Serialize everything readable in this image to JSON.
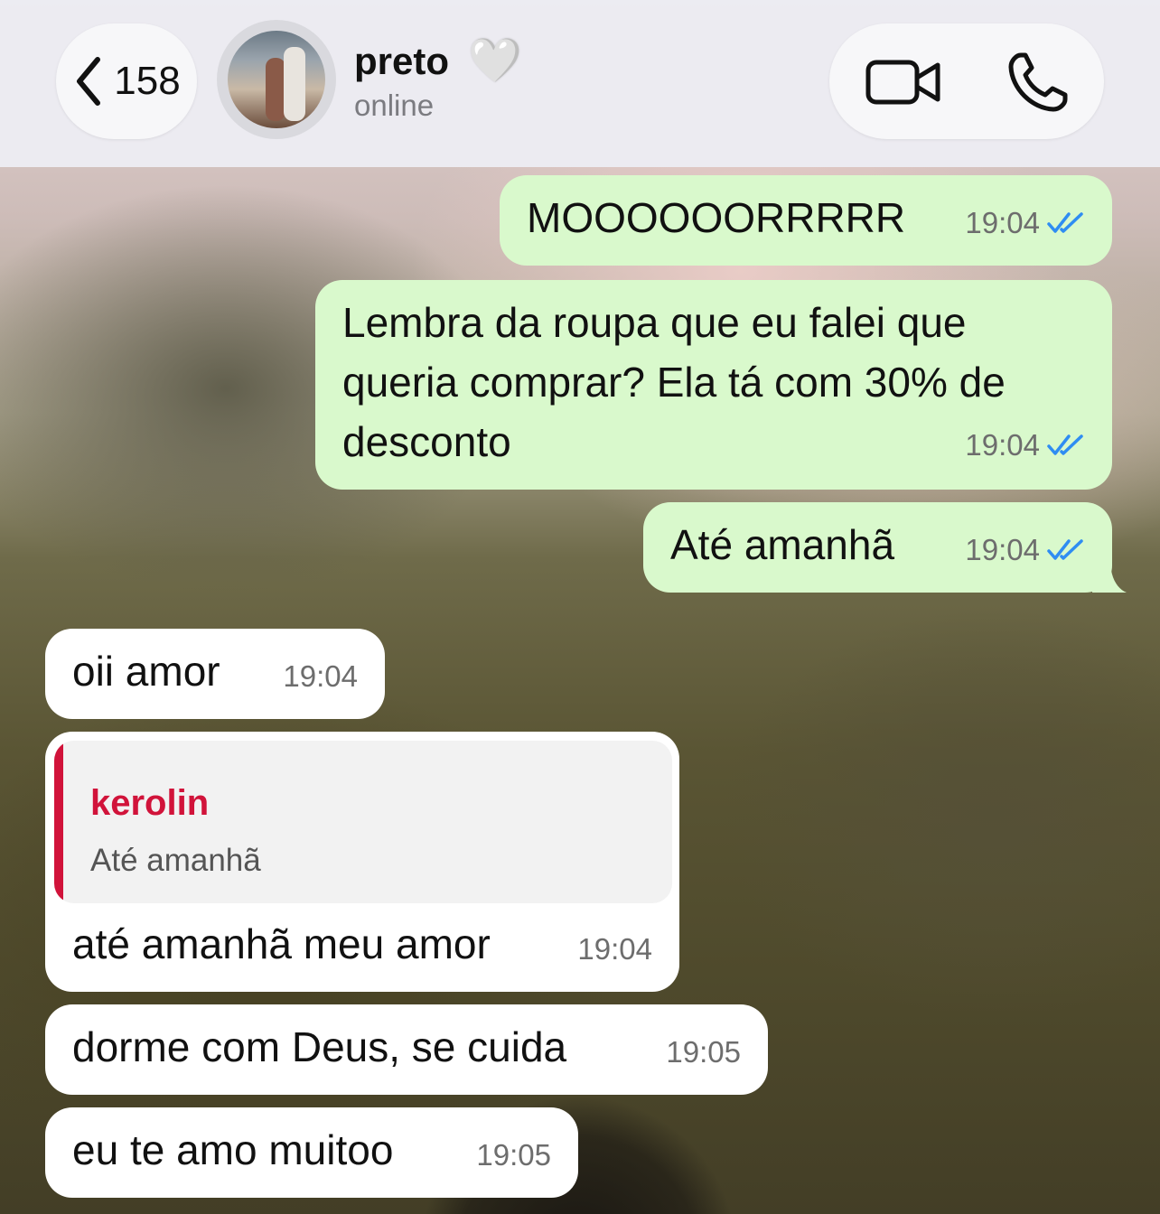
{
  "header": {
    "back_count": "158",
    "contact_name": "preto",
    "contact_emoji": "🤍",
    "contact_status": "online"
  },
  "messages": [
    {
      "direction": "outgoing",
      "text": "MOOOOOORRRRR",
      "time": "19:04",
      "status": "read"
    },
    {
      "direction": "outgoing",
      "lines": [
        "Lembra da roupa que eu falei que",
        "queria comprar? Ela tá com 30% de",
        "desconto"
      ],
      "time": "19:04",
      "status": "read"
    },
    {
      "direction": "outgoing",
      "text": "Até amanhã",
      "time": "19:04",
      "status": "read"
    },
    {
      "direction": "incoming",
      "text": "oii amor",
      "time": "19:04"
    },
    {
      "direction": "incoming",
      "reply_to": {
        "author": "kerolin",
        "text": "Até amanhã"
      },
      "text": "até amanhã meu amor",
      "time": "19:04"
    },
    {
      "direction": "incoming",
      "text": "dorme com Deus, se cuida",
      "time": "19:05"
    },
    {
      "direction": "incoming",
      "text": "eu te amo muitoo",
      "time": "19:05"
    }
  ],
  "colors": {
    "outgoing_bubble": "#d9f9cc",
    "incoming_bubble": "#ffffff",
    "read_ticks": "#2f8df2",
    "reply_accent": "#d1133a"
  },
  "icons": [
    "chevron-left-icon",
    "video-call-icon",
    "phone-call-icon",
    "double-check-icon"
  ]
}
